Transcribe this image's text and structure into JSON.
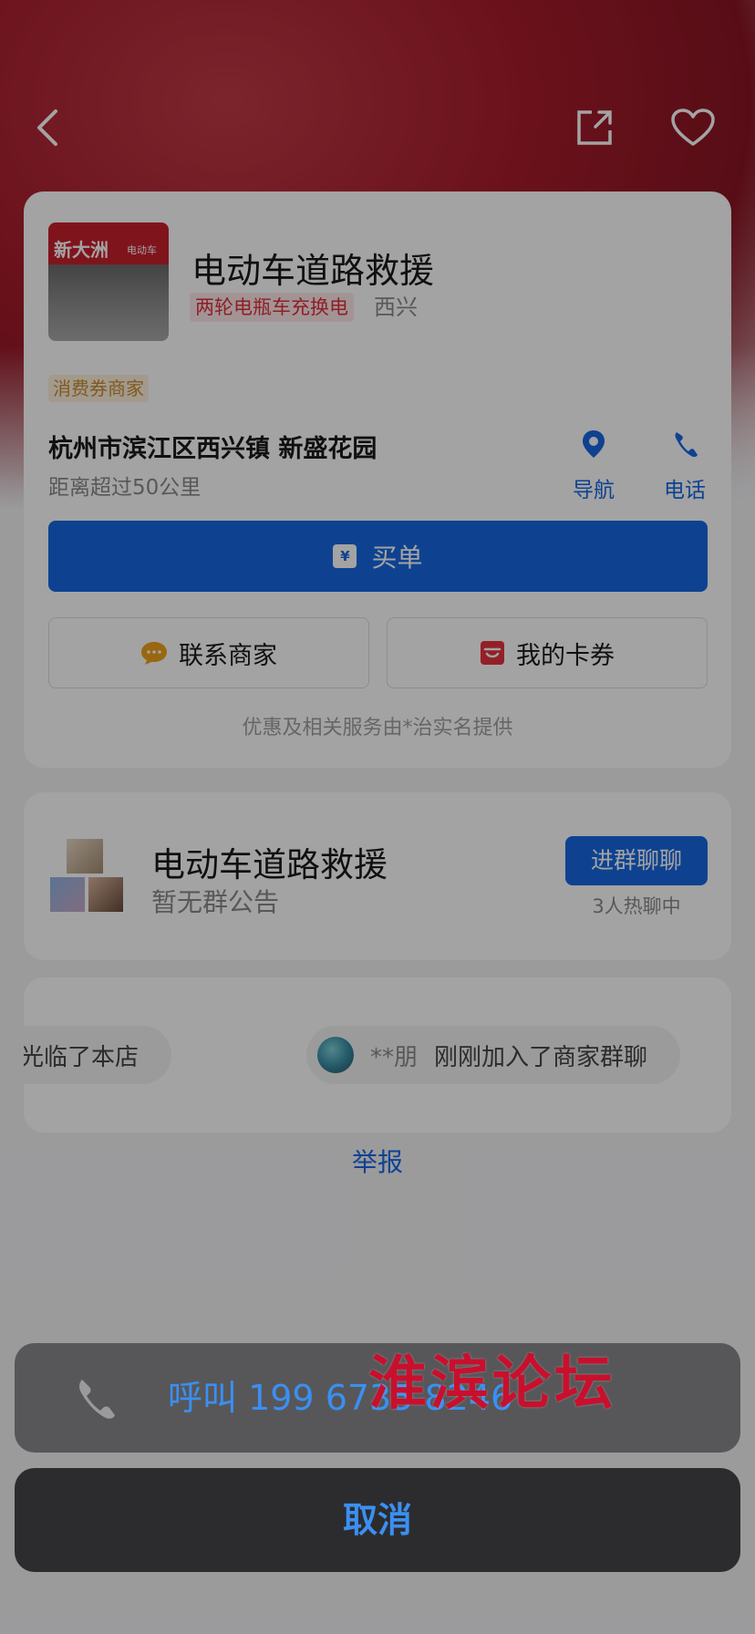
{
  "store": {
    "name": "电动车道路救援",
    "category_tag": "两轮电瓶车充换电",
    "area": "西兴",
    "merchant_badge": "消费券商家",
    "address": "杭州市滨江区西兴镇 新盛花园",
    "distance": "距离超过50公里",
    "thumbnail": {
      "sign_text": "新大洲",
      "sign_sub": "电动车"
    }
  },
  "actions": {
    "navigate_label": "导航",
    "phone_label": "电话",
    "pay_icon": "¥",
    "pay_label": "买单",
    "contact_label": "联系商家",
    "coupons_label": "我的卡券",
    "provider_note": "优惠及相关服务由*治实名提供"
  },
  "group": {
    "title": "电动车道路救援",
    "notice": "暂无群公告",
    "join_label": "进群聊聊",
    "online_count": "3人热聊中"
  },
  "feed": [
    {
      "text": "光临了本店"
    },
    {
      "user": "**朋",
      "text": "刚刚加入了商家群聊"
    }
  ],
  "report_label": "举报",
  "sheet": {
    "call_label": "呼叫 199 6735 8246",
    "cancel_label": "取消"
  },
  "watermark": "淮滨论坛",
  "colors": {
    "accent_blue": "#1668e3",
    "sheet_blue": "#3b8ff2",
    "tag_red": "#e0303c",
    "badge_gold": "#c98c2e",
    "hero_red": "#a71c2c"
  },
  "icons": {
    "back": "back-chevron-icon",
    "share": "share-icon",
    "favorite": "heart-icon",
    "navigate": "location-pin-icon",
    "phone": "phone-icon",
    "contact": "chat-bubble-icon",
    "coupons": "coupon-icon"
  }
}
